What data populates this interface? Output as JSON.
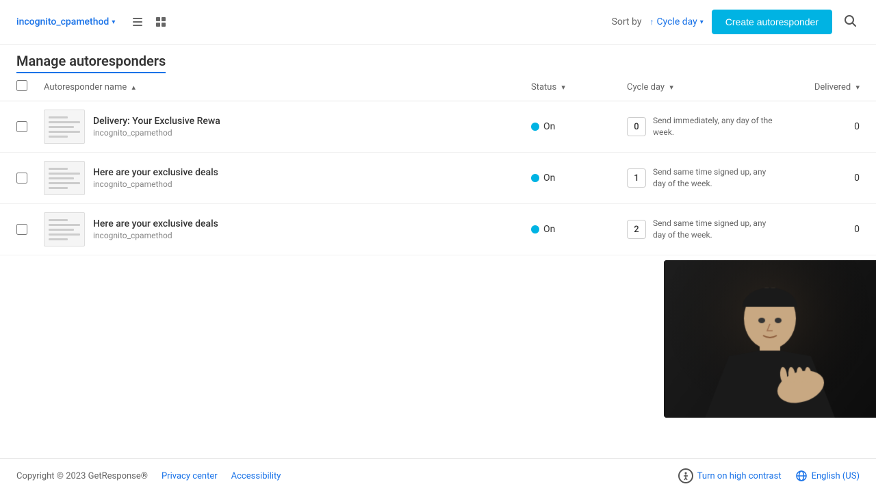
{
  "page": {
    "title": "Manage autoresponders"
  },
  "toolbar": {
    "account": "incognito_cpamethod",
    "sort_label": "Sort by",
    "sort_value": "Cycle day",
    "create_button": "Create autoresponder"
  },
  "table": {
    "columns": {
      "name": "Autoresponder name",
      "status": "Status",
      "cycle_day": "Cycle day",
      "delivered": "Delivered"
    },
    "rows": [
      {
        "name": "Delivery: Your Exclusive Rewa",
        "account": "incognito_cpamethod",
        "status": "On",
        "cycle_day": "0",
        "cycle_desc": "Send immediately, any day of the week.",
        "delivered": "0"
      },
      {
        "name": "Here are your exclusive deals",
        "account": "incognito_cpamethod",
        "status": "On",
        "cycle_day": "1",
        "cycle_desc": "Send same time signed up, any day of the week.",
        "delivered": "0"
      },
      {
        "name": "Here are your exclusive deals",
        "account": "incognito_cpamethod",
        "status": "On",
        "cycle_day": "2",
        "cycle_desc": "Send same time signed up, any day of the week.",
        "delivered": "0"
      }
    ]
  },
  "footer": {
    "copyright": "Copyright © 2023 GetResponse®",
    "privacy_center": "Privacy center",
    "accessibility": "Accessibility",
    "high_contrast": "Turn on high contrast",
    "language": "English (US)"
  }
}
